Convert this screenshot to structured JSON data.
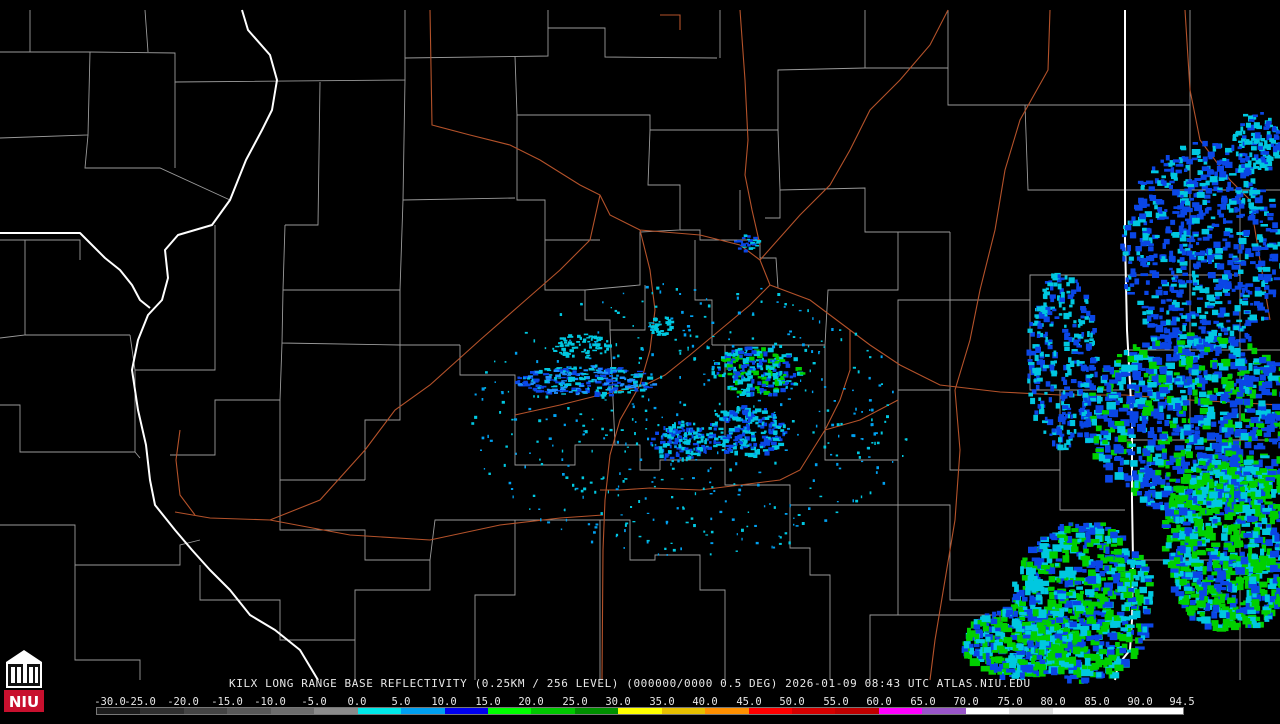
{
  "map": {
    "caption": "KILX LONG RANGE BASE REFLECTIVITY (0.25KM / 256 LEVEL) (000000/0000 0.5 DEG) 2026-01-09 08:43 UTC  ATLAS.NIU.EDU",
    "radar_site": "KILX",
    "product": "Long Range Base Reflectivity",
    "timestamp": "2026-01-09 08:43 UTC",
    "source": "ATLAS.NIU.EDU"
  },
  "logo": {
    "text": "NIU",
    "icon": "niu-logo-icon",
    "color": "#c8102e"
  },
  "legend": {
    "labels": [
      "-30.0",
      "-25.0",
      "-20.0",
      "-15.0",
      "-10.0",
      "-5.0",
      "0.0",
      "5.0",
      "10.0",
      "15.0",
      "20.0",
      "25.0",
      "30.0",
      "35.0",
      "40.0",
      "45.0",
      "50.0",
      "55.0",
      "60.0",
      "65.0",
      "70.0",
      "75.0",
      "80.0",
      "85.0",
      "90.0",
      "94.5"
    ],
    "colors": [
      "#1c1c1c",
      "#303030",
      "#444444",
      "#585858",
      "#6c6c6c",
      "#8a8a8a",
      "#00e8e8",
      "#00a0f0",
      "#0000f0",
      "#00ff00",
      "#00c800",
      "#009000",
      "#ffff00",
      "#e7c000",
      "#ff9000",
      "#ff0000",
      "#d60000",
      "#c00000",
      "#ff00ff",
      "#9955c9",
      "#ffffff",
      "#e0e0e0",
      "#ffffff",
      "#ffffff",
      "#ffffff"
    ]
  },
  "colors": {
    "background": "#000000",
    "county_borders": "#9a9a9a",
    "state_borders": "#ffffff",
    "highways": "#b4522a",
    "echo_light": "#00c8e0",
    "echo_mid": "#0a46e6",
    "echo_heavy": "#00d000"
  }
}
